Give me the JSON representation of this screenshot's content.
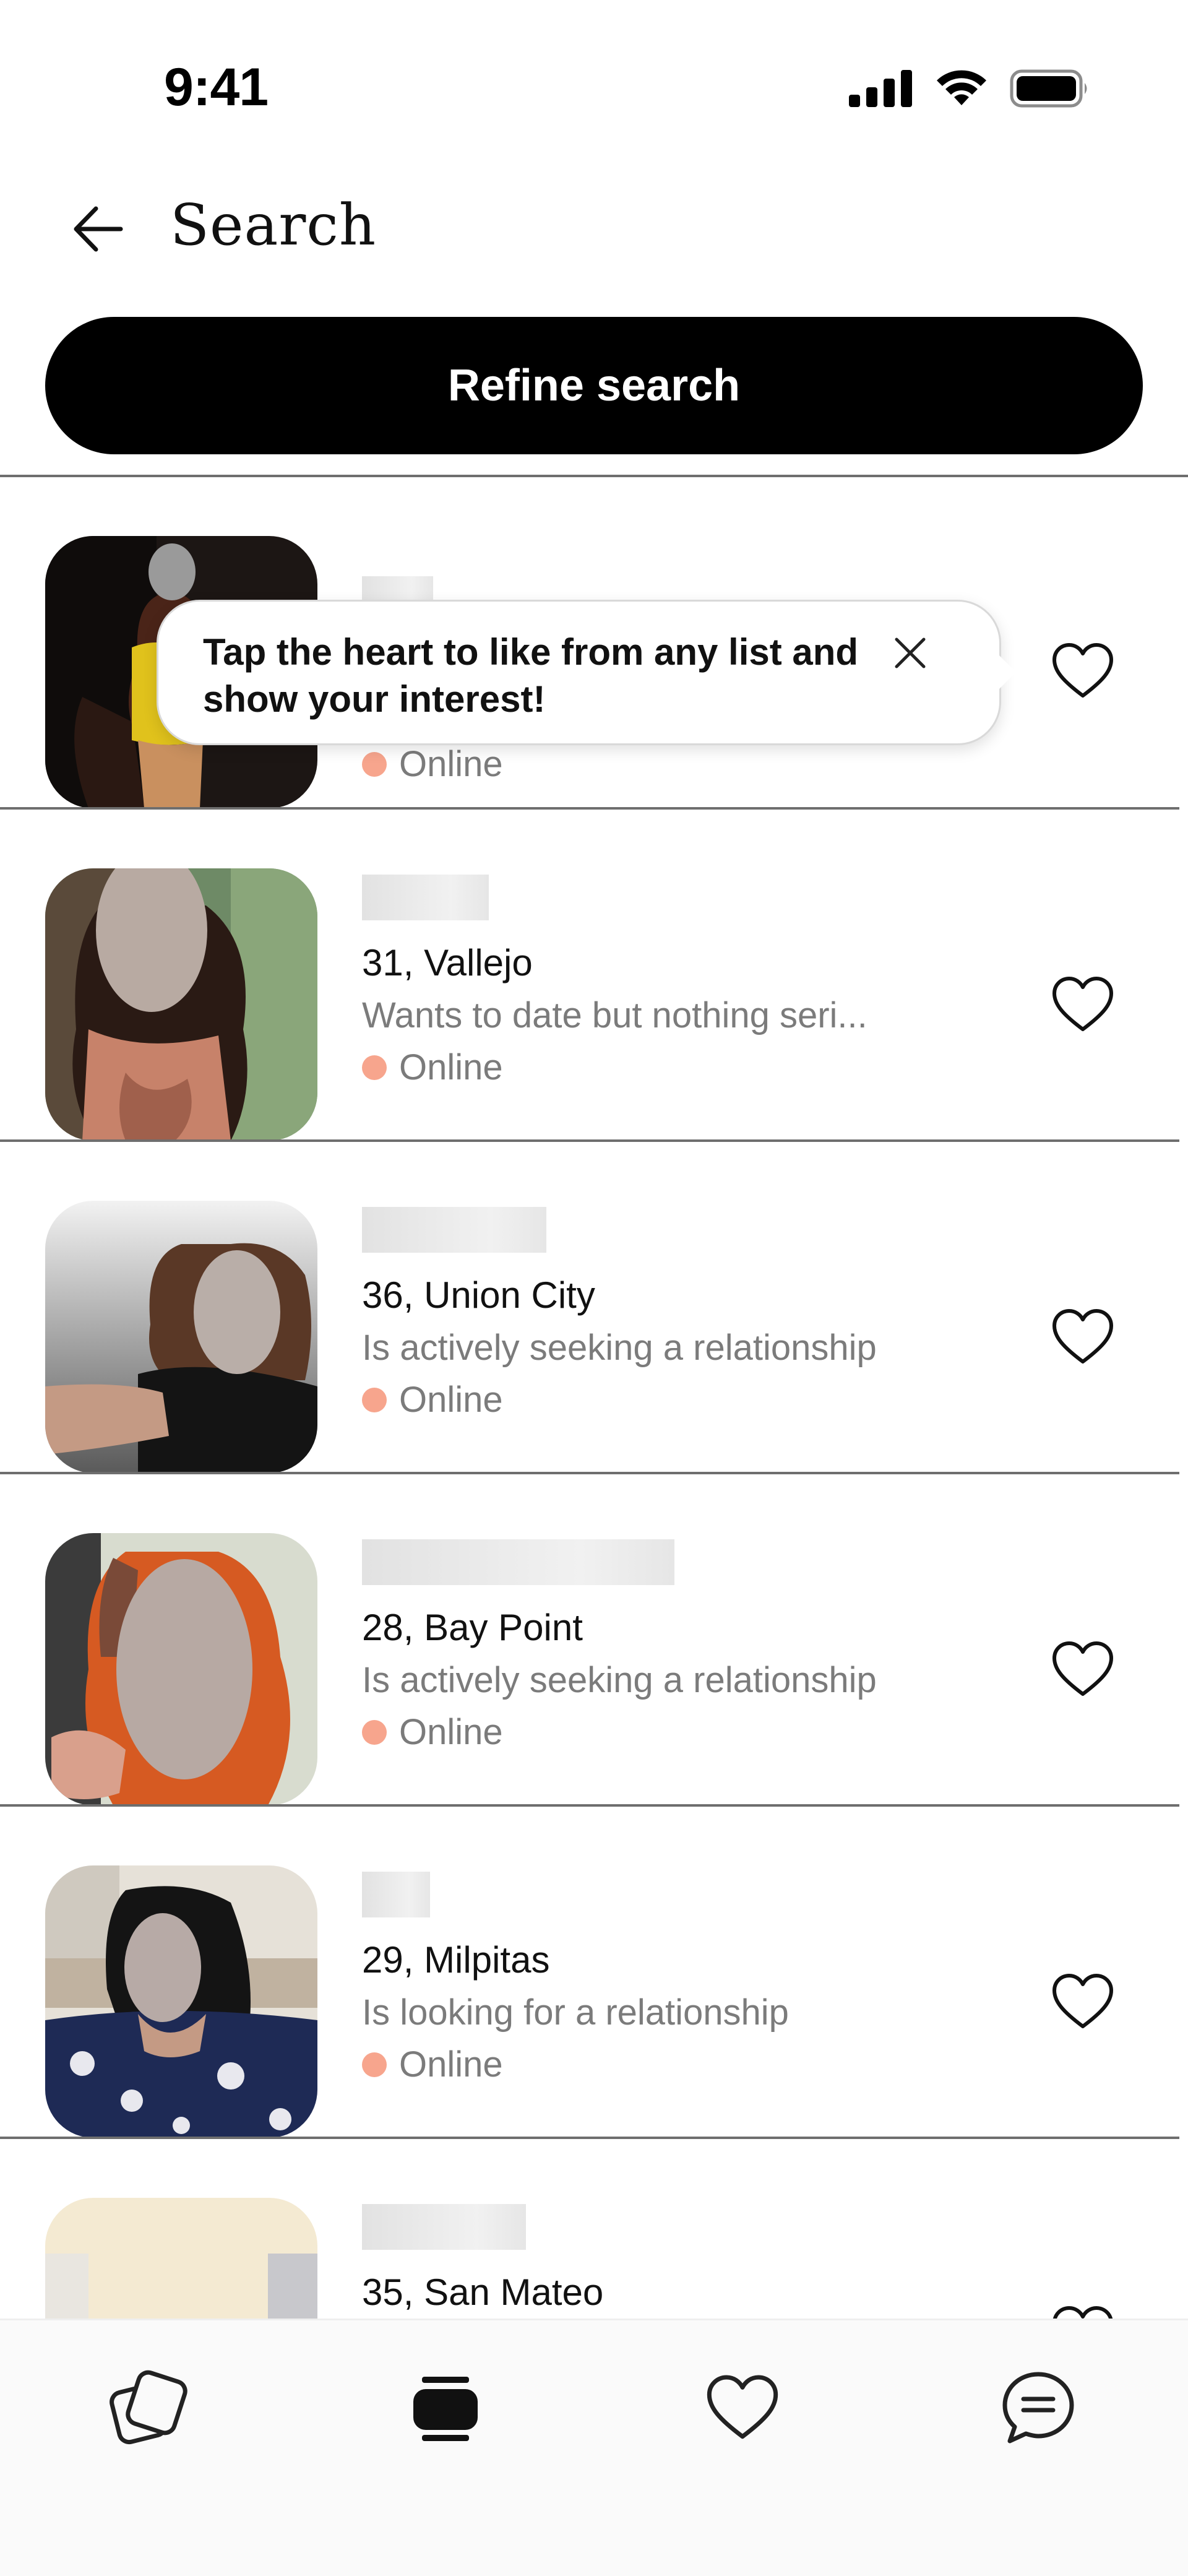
{
  "status_bar": {
    "time": "9:41"
  },
  "header": {
    "title": "Search"
  },
  "refine_button": {
    "label": "Refine search"
  },
  "tooltip": {
    "text": "Tap the heart to like from any list and show your interest!"
  },
  "results": [
    {
      "age_city": "",
      "seeking": "",
      "online": "Online"
    },
    {
      "age_city": "31, Vallejo",
      "seeking": "Wants to date but nothing seri...",
      "online": "Online"
    },
    {
      "age_city": "36, Union City",
      "seeking": "Is actively seeking a relationship",
      "online": "Online"
    },
    {
      "age_city": "28, Bay Point",
      "seeking": "Is actively seeking a relationship",
      "online": "Online"
    },
    {
      "age_city": "29, Milpitas",
      "seeking": "Is looking for a relationship",
      "online": "Online"
    },
    {
      "age_city": "35, San Mateo",
      "seeking": "",
      "online": ""
    }
  ],
  "bottom_nav": [
    {
      "icon": "discover-cards-icon"
    },
    {
      "icon": "search-list-icon"
    },
    {
      "icon": "likes-heart-icon"
    },
    {
      "icon": "messages-chat-icon"
    }
  ],
  "colors": {
    "online_dot": "#f7a58d",
    "primary": "#000000",
    "secondary_text": "#7b7b7b"
  }
}
